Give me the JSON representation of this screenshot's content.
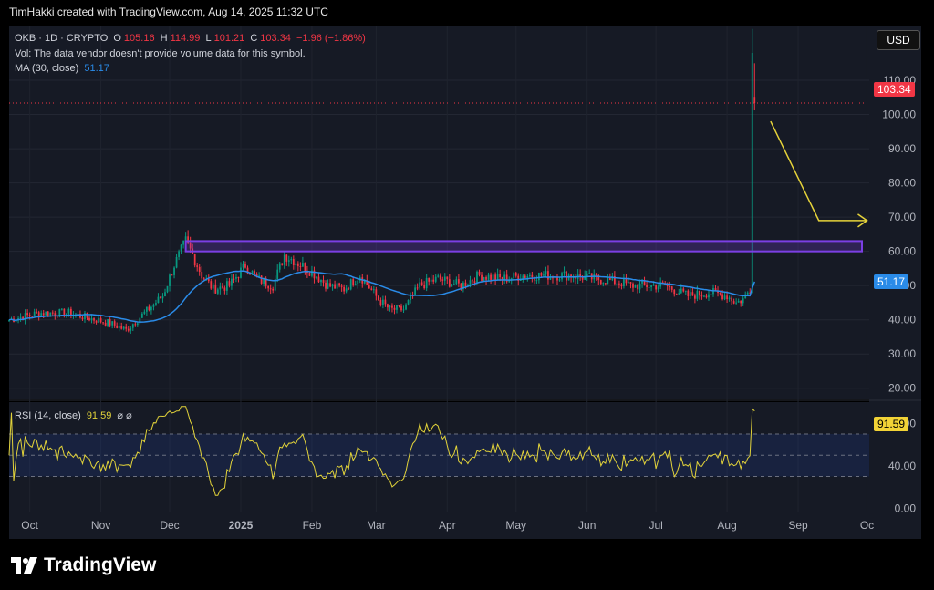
{
  "header": {
    "text": "TimHakki created with TradingView.com, Aug 14, 2025 11:32 UTC"
  },
  "legend": {
    "symbol": "OKB · 1D · CRYPTO",
    "open_label": "O",
    "open": "105.16",
    "high_label": "H",
    "high": "114.99",
    "low_label": "L",
    "low": "101.21",
    "close_label": "C",
    "close": "103.34",
    "change": "−1.96 (−1.86%)",
    "volume_note": "Vol: The data vendor doesn't provide volume data for this symbol.",
    "ma_label": "MA (30, close)",
    "ma_value": "51.17",
    "rsi_label": "RSI (14, close)",
    "rsi_value": "91.59",
    "rsi_icons": "⌀ ⌀"
  },
  "currency": "USD",
  "badges": {
    "price": "103.34",
    "ma": "51.17",
    "rsi": "91.59"
  },
  "brand": "TradingView",
  "colors": {
    "up": "#089981",
    "down": "#f23645",
    "ma": "#2a8be8",
    "rsi": "#e2d33a",
    "box": "#7b3fe4",
    "arrow": "#e6d33a",
    "bg": "#161a25"
  },
  "chart_data": [
    {
      "type": "candlestick",
      "title": "OKB · 1D · CRYPTO",
      "y_ticks": [
        20,
        30,
        40,
        50,
        60,
        70,
        80,
        90,
        100,
        110
      ],
      "y_tick_labels": [
        "20.00",
        "30.00",
        "40.00",
        "50.00",
        "60.00",
        "70.00",
        "80.00",
        "90.00",
        "100.00",
        "110.00"
      ],
      "ylim": [
        17,
        126
      ],
      "x_tick_labels": [
        "Oct",
        "Nov",
        "Dec",
        "2025",
        "Feb",
        "Mar",
        "Apr",
        "May",
        "Jun",
        "Jul",
        "Aug",
        "Sep",
        "Oc"
      ],
      "x_ticks": [
        "2024-10-01",
        "2024-11-01",
        "2024-12-01",
        "2025-01-01",
        "2025-02-01",
        "2025-03-01",
        "2025-04-01",
        "2025-05-01",
        "2025-06-01",
        "2025-07-01",
        "2025-08-01",
        "2025-09-01",
        "2025-10-01"
      ],
      "x_range": [
        "2024-09-22",
        "2025-10-02"
      ],
      "price_anchors": [
        [
          "2024-09-22",
          40
        ],
        [
          "2024-10-05",
          42
        ],
        [
          "2024-10-18",
          42
        ],
        [
          "2024-11-05",
          39
        ],
        [
          "2024-11-12",
          37
        ],
        [
          "2024-11-20",
          42
        ],
        [
          "2024-11-28",
          47
        ],
        [
          "2024-12-03",
          56
        ],
        [
          "2024-12-08",
          63
        ],
        [
          "2024-12-11",
          59
        ],
        [
          "2024-12-15",
          53
        ],
        [
          "2024-12-20",
          49
        ],
        [
          "2024-12-27",
          50
        ],
        [
          "2025-01-03",
          56
        ],
        [
          "2025-01-08",
          52
        ],
        [
          "2025-01-15",
          50
        ],
        [
          "2025-01-20",
          59
        ],
        [
          "2025-01-25",
          57
        ],
        [
          "2025-02-01",
          54
        ],
        [
          "2025-02-08",
          50
        ],
        [
          "2025-02-15",
          49
        ],
        [
          "2025-02-22",
          53
        ],
        [
          "2025-03-02",
          46
        ],
        [
          "2025-03-07",
          43
        ],
        [
          "2025-03-13",
          43
        ],
        [
          "2025-03-20",
          50
        ],
        [
          "2025-03-28",
          52
        ],
        [
          "2025-04-07",
          50
        ],
        [
          "2025-04-15",
          53
        ],
        [
          "2025-04-25",
          52
        ],
        [
          "2025-05-05",
          53
        ],
        [
          "2025-05-15",
          53
        ],
        [
          "2025-05-25",
          53
        ],
        [
          "2025-06-05",
          52
        ],
        [
          "2025-06-15",
          51
        ],
        [
          "2025-06-20",
          50
        ],
        [
          "2025-06-26",
          50
        ],
        [
          "2025-07-05",
          50
        ],
        [
          "2025-07-15",
          47
        ],
        [
          "2025-07-25",
          48
        ],
        [
          "2025-08-01",
          47
        ],
        [
          "2025-08-05",
          45
        ],
        [
          "2025-08-08",
          46
        ],
        [
          "2025-08-11",
          49
        ],
        [
          "2025-08-12",
          103
        ]
      ],
      "spike_candle": {
        "date": "2025-08-13",
        "open": 105.16,
        "high": 114.99,
        "low": 101.21,
        "close": 103.34
      },
      "ma_period": 30,
      "ma_last": 51.17,
      "last_price": 103.34,
      "resistance_box": {
        "from": "2024-12-08",
        "to": "2025-10-02",
        "low": 60,
        "high": 63
      },
      "arrow_target": 69
    },
    {
      "type": "line",
      "title": "RSI (14, close)",
      "y_ticks": [
        0,
        40,
        80
      ],
      "y_tick_labels": [
        "0.00",
        "40.00",
        "80.00"
      ],
      "ylim": [
        -3,
        100
      ],
      "band": [
        30,
        70
      ],
      "last_value": 91.59
    }
  ]
}
